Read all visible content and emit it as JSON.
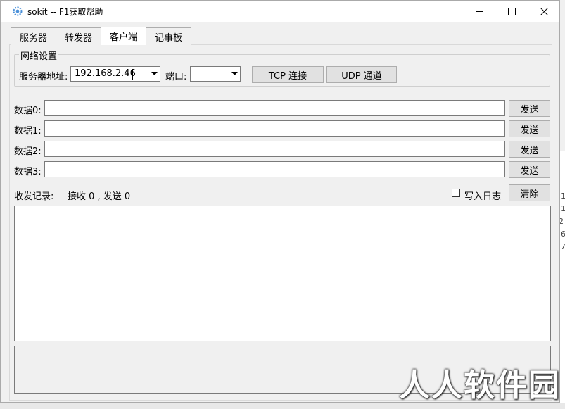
{
  "window": {
    "title": "sokit -- F1获取帮助"
  },
  "tabs": [
    {
      "label": "服务器",
      "active": false
    },
    {
      "label": "转发器",
      "active": false
    },
    {
      "label": "客户端",
      "active": true
    },
    {
      "label": "记事板",
      "active": false
    }
  ],
  "network": {
    "group_title": "网络设置",
    "server_addr_label": "服务器地址:",
    "server_addr_value": "192.168.2.46",
    "port_label": "端口:",
    "port_value": "",
    "tcp_button": "TCP 连接",
    "udp_button": "UDP 通道"
  },
  "data_rows": [
    {
      "label": "数据0:",
      "value": "",
      "send": "发送"
    },
    {
      "label": "数据1:",
      "value": "",
      "send": "发送"
    },
    {
      "label": "数据2:",
      "value": "",
      "send": "发送"
    },
    {
      "label": "数据3:",
      "value": "",
      "send": "发送"
    }
  ],
  "log": {
    "label": "收发记录:",
    "counter": "接收 0 , 发送 0",
    "write_log_label": "写入日志",
    "write_log_checked": false,
    "clear_button": "清除"
  },
  "background": {
    "right_digits": [
      "1",
      "1",
      "2",
      "6",
      "7"
    ]
  },
  "watermark": "人人软件园"
}
